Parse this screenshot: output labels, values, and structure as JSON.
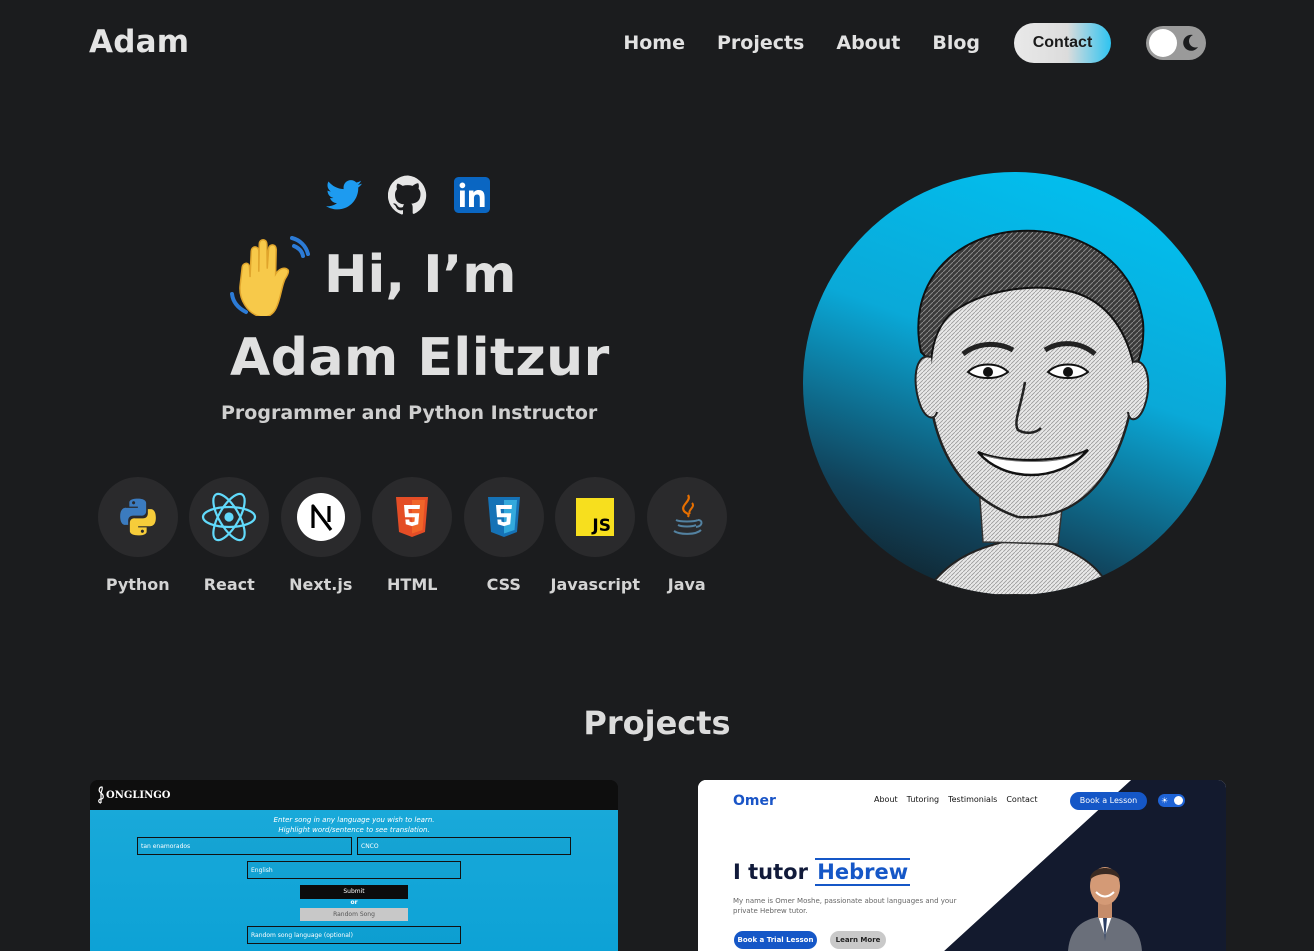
{
  "header": {
    "brand": "Adam",
    "nav": [
      "Home",
      "Projects",
      "About",
      "Blog"
    ],
    "contact_label": "Contact",
    "theme_toggle": "dark-mode-toggle"
  },
  "hero": {
    "socials": [
      "twitter-icon",
      "github-icon",
      "linkedin-icon"
    ],
    "greeting": "Hi, I’m",
    "name": "Adam Elitzur",
    "subtitle": "Programmer and Python Instructor",
    "skills": [
      {
        "label": "Python",
        "icon": "python-icon"
      },
      {
        "label": "React",
        "icon": "react-icon"
      },
      {
        "label": "Next.js",
        "icon": "nextjs-icon"
      },
      {
        "label": "HTML",
        "icon": "html5-icon"
      },
      {
        "label": "CSS",
        "icon": "css3-icon"
      },
      {
        "label": "Javascript",
        "icon": "javascript-icon"
      },
      {
        "label": "Java",
        "icon": "java-icon"
      }
    ]
  },
  "projects": {
    "title": "Projects",
    "songlingo": {
      "logo": "ONGLINGO",
      "hint_line1": "Enter song in any language you wish to learn.",
      "hint_line2": "Highlight word/sentence to see translation.",
      "song_value": "tan enamorados",
      "artist_value": "CNCO",
      "language_value": "English",
      "submit_label": "Submit",
      "or_label": "or",
      "random_label": "Random Song",
      "random_lang_placeholder": "Random song language (optional)"
    },
    "omer": {
      "logo": "Omer",
      "nav": [
        "About",
        "Tutoring",
        "Testimonials",
        "Contact"
      ],
      "book_label": "Book a Lesson",
      "headline_prefix": "I tutor",
      "headline_word": "Hebrew",
      "description": "My name is Omer Moshe, passionate about languages and your private Hebrew tutor.",
      "trial_label": "Book a Trial Lesson",
      "learn_label": "Learn More"
    }
  },
  "colors": {
    "background": "#1b1c1e",
    "accent": "#00c4f4"
  }
}
